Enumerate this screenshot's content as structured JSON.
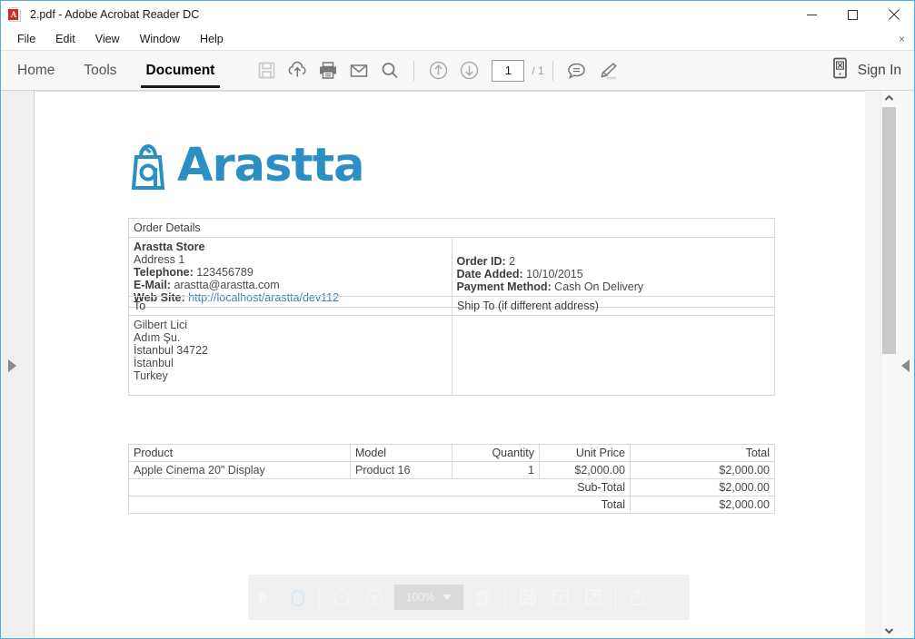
{
  "window": {
    "title": "2.pdf - Adobe Acrobat Reader DC",
    "app_icon": "pdf-file-icon",
    "minimize_label": "Minimize",
    "maximize_label": "Maximize",
    "close_label": "Close"
  },
  "menubar": {
    "items": [
      "File",
      "Edit",
      "View",
      "Window",
      "Help"
    ],
    "close_label": "×"
  },
  "toolbar": {
    "tabs": [
      {
        "label": "Home",
        "active": false
      },
      {
        "label": "Tools",
        "active": false
      },
      {
        "label": "Document",
        "active": true
      }
    ],
    "icons": [
      "save-icon",
      "cloud-upload-icon",
      "print-icon",
      "email-icon",
      "search-icon"
    ],
    "page_prev_icon": "arrow-up-circle-icon",
    "page_next_icon": "arrow-down-circle-icon",
    "page_current": "1",
    "page_total": "/ 1",
    "comment_icon": "comment-bubble-icon",
    "highlight_icon": "highlighter-icon",
    "signin_icon": "mobile-device-icon",
    "signin_label": "Sign In"
  },
  "viewer": {
    "left_panel_toggle": "expand-left-panel-arrow",
    "right_panel_toggle": "collapse-right-panel-arrow",
    "scroll_up_icon": "chevron-up-icon",
    "scroll_down_icon": "chevron-down-icon"
  },
  "floating_toolbar": {
    "select_icon": "cursor-select-icon",
    "hand_icon": "hand-pan-icon",
    "zoom_out_icon": "zoom-out-icon",
    "zoom_in_icon": "zoom-in-icon",
    "zoom_level": "100%",
    "fit_page_icon": "fit-page-icon",
    "save_icon": "save-icon",
    "snapshot_icon": "snapshot-icon",
    "fullscreen_icon": "fullscreen-icon",
    "share_icon": "share-upload-icon"
  },
  "document": {
    "logo": {
      "mark": "arastta-bag-icon",
      "word": "Arastta",
      "color": "#2b8fc4"
    },
    "order_details": {
      "section_title": "Order Details",
      "store": {
        "name": "Arastta Store",
        "address": "Address 1",
        "telephone_label": "Telephone:",
        "telephone": "123456789",
        "email_label": "E-Mail:",
        "email": "arastta@arastta.com",
        "website_label": "Web Site:",
        "website": "http://localhost/arastta/dev112"
      },
      "order": {
        "order_id_label": "Order ID:",
        "order_id": "2",
        "date_added_label": "Date Added:",
        "date_added": "10/10/2015",
        "payment_method_label": "Payment Method:",
        "payment_method": "Cash On Delivery"
      }
    },
    "addresses": {
      "to_header": "To",
      "ship_to_header": "Ship To (if different address)",
      "to_lines": [
        "Gilbert Lici",
        "Adım Şu.",
        "İstanbul 34722",
        "İstanbul",
        "Turkey"
      ],
      "ship_to_lines": []
    },
    "products": {
      "headers": [
        "Product",
        "Model",
        "Quantity",
        "Unit Price",
        "Total"
      ],
      "rows": [
        {
          "product": "Apple Cinema 20\" Display",
          "model": "Product 16",
          "quantity": "1",
          "unit_price": "$2,000.00",
          "total": "$2,000.00"
        }
      ],
      "totals": [
        {
          "label": "Sub-Total",
          "value": "$2,000.00"
        },
        {
          "label": "Total",
          "value": "$2,000.00"
        }
      ]
    }
  }
}
